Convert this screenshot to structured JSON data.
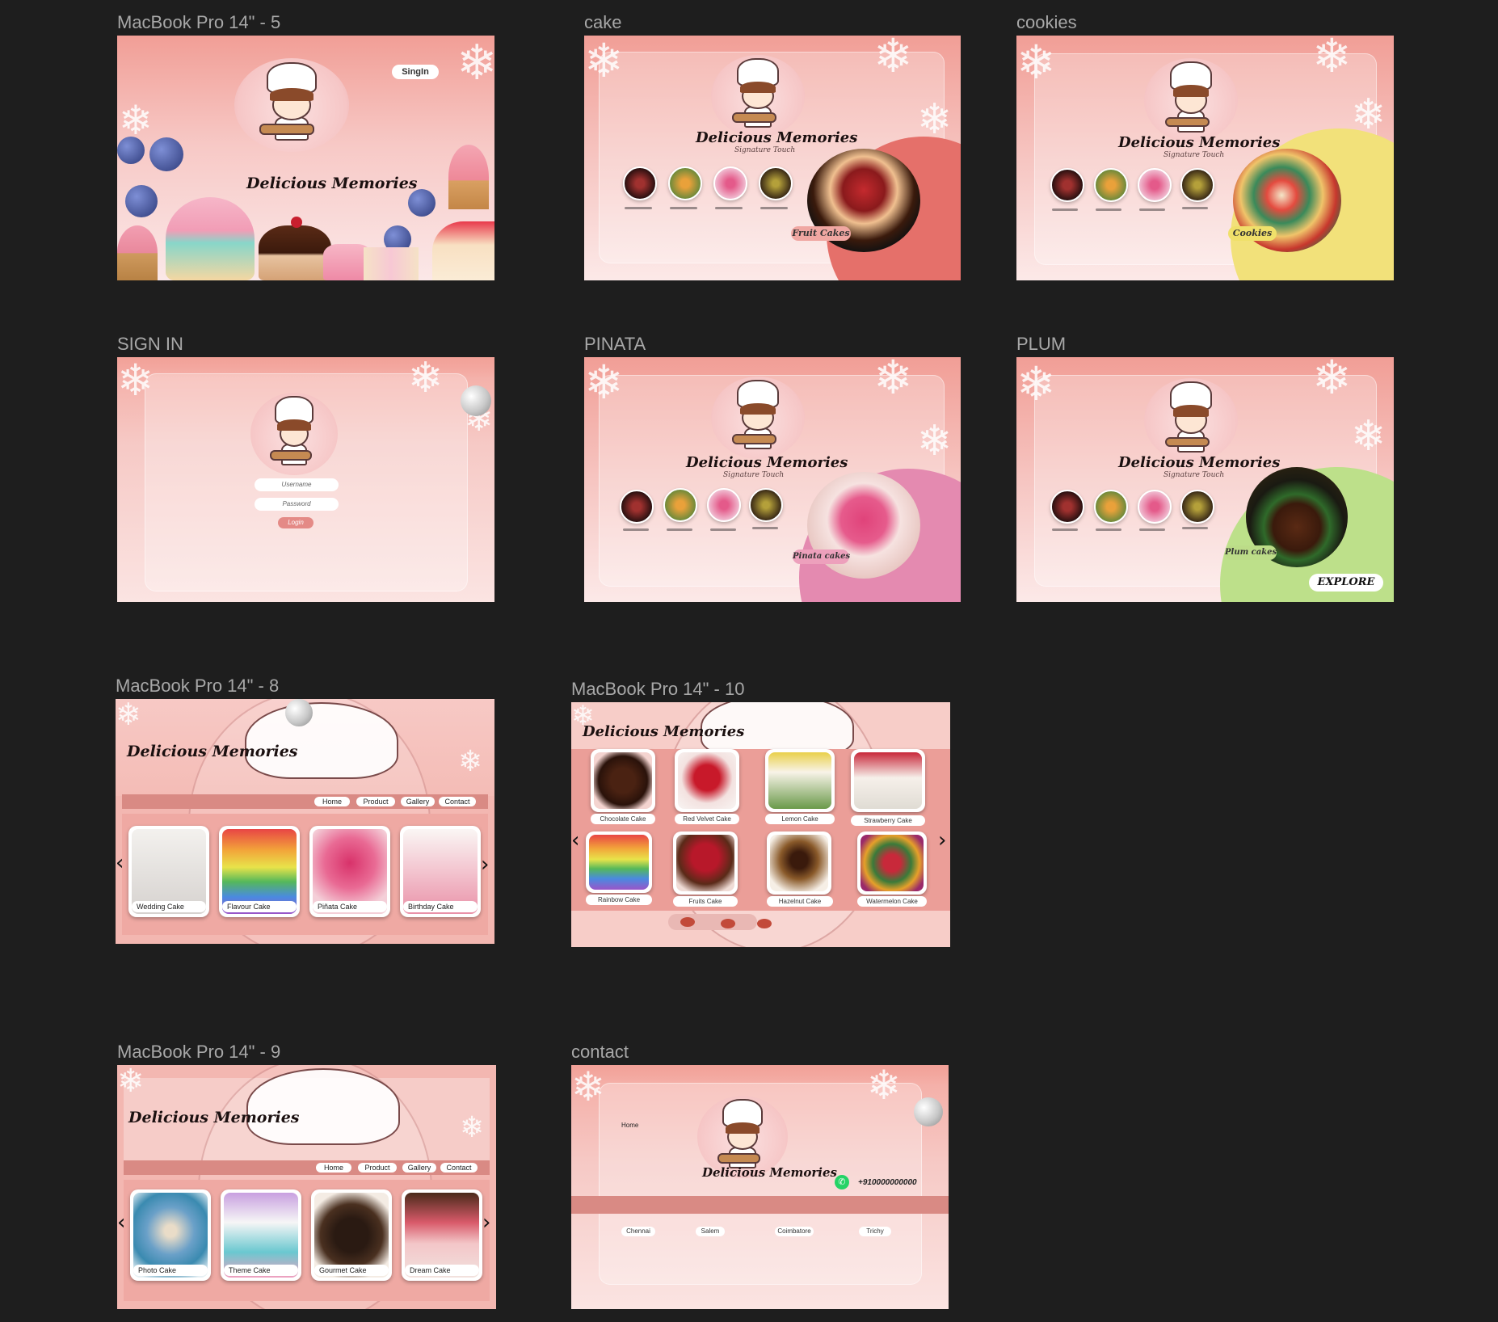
{
  "frames": {
    "f1": {
      "label": "MacBook Pro 14\" - 5",
      "signin": "SingIn",
      "title": "Delicious Memories"
    },
    "f2": {
      "label": "cake",
      "title": "Delicious Memories",
      "tagline": "Signature Touch",
      "product": "Fruit Cakes"
    },
    "f3": {
      "label": "cookies",
      "title": "Delicious Memories",
      "tagline": "Signature Touch",
      "product": "Cookies"
    },
    "f4": {
      "label": "SIGN IN",
      "username": "Username",
      "password": "Password",
      "login": "Login"
    },
    "f5": {
      "label": "PINATA",
      "title": "Delicious Memories",
      "tagline": "Signature Touch",
      "product": "Pinata cakes"
    },
    "f6": {
      "label": "PLUM",
      "title": "Delicious Memories",
      "tagline": "Signature Touch",
      "product": "Plum cakes",
      "explore": "EXPLORE"
    },
    "f7": {
      "label": "MacBook Pro 14\" - 8",
      "title": "Delicious Memories",
      "nav": [
        "Home",
        "Product",
        "Gallery",
        "Contact"
      ],
      "cards": [
        "Wedding Cake",
        "Flavour Cake",
        "Piñata Cake",
        "Birthday Cake"
      ]
    },
    "f8": {
      "label": "MacBook Pro 14\" - 10",
      "title": "Delicious Memories",
      "row1": [
        "Chocolate Cake",
        "Red Velvet Cake",
        "Lemon Cake",
        "Strawberry Cake"
      ],
      "row2": [
        "Rainbow Cake",
        "Fruits Cake",
        "Hazelnut Cake",
        "Watermelon Cake"
      ]
    },
    "f9": {
      "label": "MacBook Pro 14\" - 9",
      "title": "Delicious Memories",
      "nav": [
        "Home",
        "Product",
        "Gallery",
        "Contact"
      ],
      "cards": [
        "Photo Cake",
        "Theme Cake",
        "Gourmet Cake",
        "Dream Cake"
      ]
    },
    "f10": {
      "label": "contact",
      "home": "Home",
      "title": "Delicious Memories",
      "phone": "+910000000000",
      "cities": [
        "Chennai",
        "Salem",
        "Coimbatore",
        "Trichy"
      ]
    }
  },
  "icons": {
    "prev": "chevron-left-icon",
    "next": "chevron-right-icon",
    "whatsapp": "whatsapp-icon",
    "snowflake": "snowflake-icon"
  },
  "colors": {
    "canvas": "#1e1e1e",
    "pink": "#f2a59c",
    "pinkLight": "#fbe4e2",
    "band": "#d98a84",
    "label": "#a8a8a8"
  }
}
